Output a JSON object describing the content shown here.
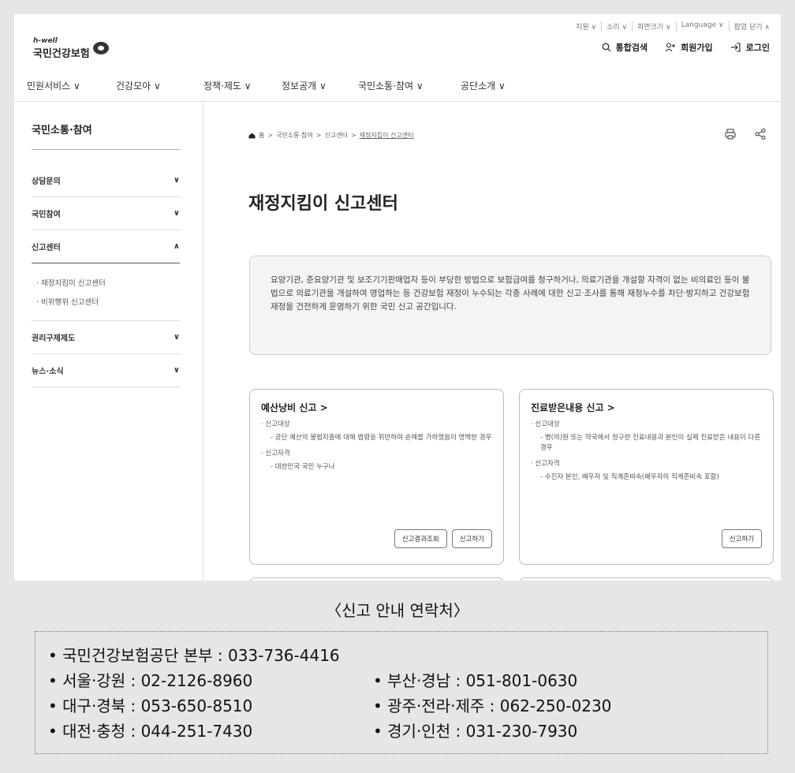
{
  "utility": [
    "지원 ∨",
    "소리 ∨",
    "화면크기 ∨",
    "Language ∨",
    "팝업 닫기 ∧"
  ],
  "logo": {
    "small": "h-well",
    "name": "국민건강보험"
  },
  "top_actions": {
    "search": "통합검색",
    "join": "회원가입",
    "login": "로그인"
  },
  "gnb": [
    "민원서비스 ∨",
    "건강모아 ∨",
    "정책·제도 ∨",
    "정보공개 ∨",
    "국민소통·참여 ∨",
    "공단소개 ∨"
  ],
  "sidebar": {
    "title": "국민소통·참여",
    "items": [
      {
        "label": "상담문의",
        "chev": "∨"
      },
      {
        "label": "국민참여",
        "chev": "∨"
      },
      {
        "label": "신고센터",
        "chev": "∧"
      }
    ],
    "sub": [
      "· 재정지킴이 신고센터",
      "· 비위행위 신고센터"
    ],
    "items2": [
      {
        "label": "권리구제제도",
        "chev": "∨"
      },
      {
        "label": "뉴스·소식",
        "chev": "∨"
      }
    ]
  },
  "breadcrumb": [
    "홈",
    "국민소통·참여",
    "신고센터",
    "재정지킴이 신고센터"
  ],
  "page_title": "재정지킴이 신고센터",
  "intro": "요양기관, 준요양기관 및 보조기기판매업자 등이 부당한 방법으로 보험급여를 청구하거나, 의료기관을 개설할 자격이 없는 비의료인 등이 불법으로 의료기관을 개설하여 영업하는 등 건강보험 재정이 누수되는 각종 사례에 대한 신고·조사를 통해 재정누수를 차단·방지하고 건강보험 재정을 건전하게 운영하기 위한 국민 신고 공간입니다.",
  "cards": [
    {
      "title": "예산낭비 신고 >",
      "target_label": "· 신고대상",
      "target": "- 공단 예산의 불법지출에 대해 법령을 위반하여 손해를 가하였음이 명백한 경우",
      "qual_label": "· 신고자격",
      "qual": "- 대한민국 국민 누구나",
      "buttons": [
        "신고결과조회",
        "신고하기"
      ]
    },
    {
      "title": "진료받은내용 신고 >",
      "target_label": "· 신고대상",
      "target": "- 병(의)원 또는 약국에서 청구한 진료내용과 본인이 실제 진료받은 내용이 다른 경우",
      "qual_label": "· 신고자격",
      "qual": "- 수진자 본인, 배우자 및 직계존비속(배우자의 직계존비속 포함)",
      "buttons": [
        "신고하기"
      ]
    }
  ],
  "contact_title": "〈신고 안내 연락처〉",
  "contacts": [
    [
      "• 국민건강보험공단 본부 : 033-736-4416",
      ""
    ],
    [
      "• 서울·강원 : 02-2126-8960",
      "• 부산·경남 : 051-801-0630"
    ],
    [
      "• 대구·경북 : 053-650-8510",
      "• 광주·전라·제주 : 062-250-0230"
    ],
    [
      "• 대전·충청 : 044-251-7430",
      "• 경기·인천 : 031-230-7930"
    ]
  ]
}
